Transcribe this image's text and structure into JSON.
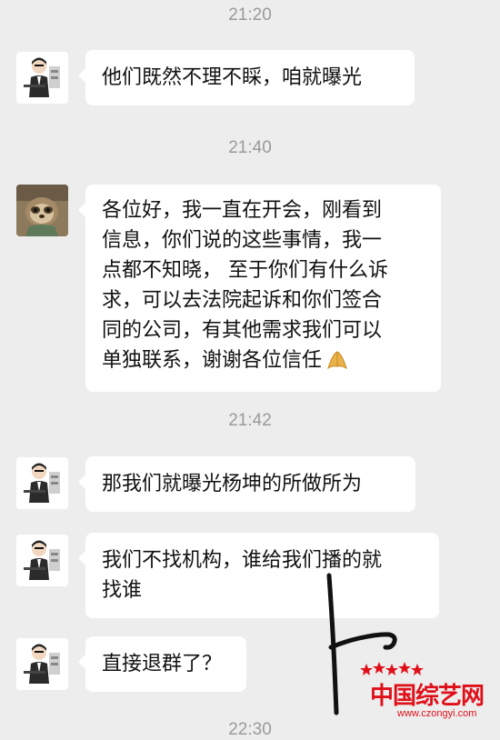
{
  "timestamps": [
    "21:20",
    "21:40",
    "21:42",
    "22:30"
  ],
  "messages": [
    {
      "sender": "user",
      "text": "他们既然不理不睬，咱就曝光"
    },
    {
      "sender": "sloth",
      "lines": [
        "各位好，我一直在开会，刚看到",
        "信息，你们说的这些事情，我一",
        "点都不知晓， 至于你们有什么诉",
        "求，可以去法院起诉和你们签合",
        "同的公司，有其他需求我们可以",
        "单独联系，谢谢各位信任"
      ]
    },
    {
      "sender": "user",
      "text": "那我们就曝光杨坤的所做所为"
    },
    {
      "sender": "user",
      "lines": [
        "我们不找机构，谁给我们播的就",
        "找谁"
      ]
    },
    {
      "sender": "user",
      "text": "直接退群了？"
    }
  ],
  "icons": {
    "user_avatar": "cartoon-man-avatar",
    "sloth_avatar": "sloth-avatar",
    "emoji": "folded-hands-emoji"
  },
  "watermark": {
    "name": "中国综艺网",
    "url": "www.czongyi.com",
    "color": "#e0101a"
  }
}
